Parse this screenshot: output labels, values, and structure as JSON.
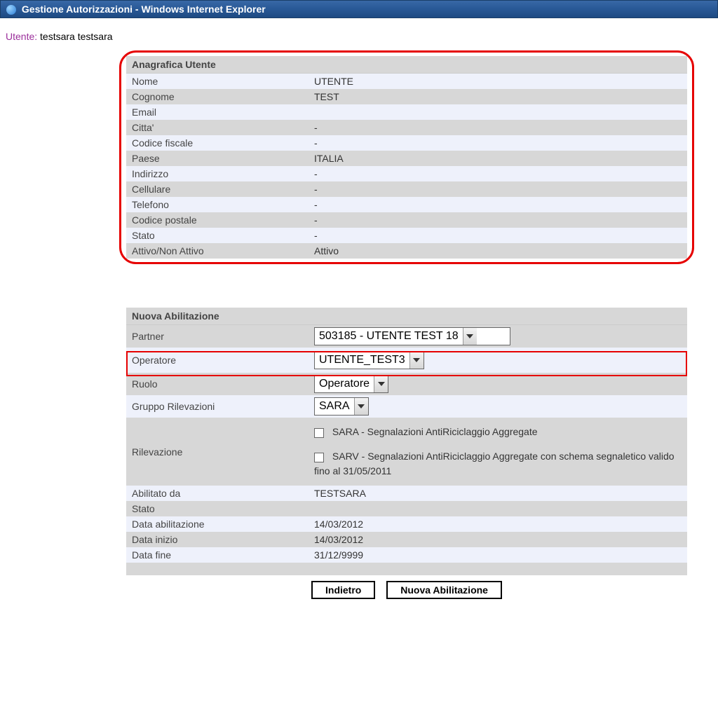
{
  "window": {
    "title": "Gestione Autorizzazioni - Windows Internet Explorer"
  },
  "user": {
    "label": "Utente:",
    "value": "testsara  testsara"
  },
  "anagrafica": {
    "header": "Anagrafica Utente",
    "rows": [
      {
        "label": "Nome",
        "value": "UTENTE"
      },
      {
        "label": "Cognome",
        "value": "TEST"
      },
      {
        "label": "Email",
        "value": ""
      },
      {
        "label": "Citta'",
        "value": "-"
      },
      {
        "label": "Codice fiscale",
        "value": "-"
      },
      {
        "label": "Paese",
        "value": "ITALIA"
      },
      {
        "label": "Indirizzo",
        "value": "-"
      },
      {
        "label": "Cellulare",
        "value": "-"
      },
      {
        "label": "Telefono",
        "value": "-"
      },
      {
        "label": "Codice postale",
        "value": "-"
      },
      {
        "label": "Stato",
        "value": "-"
      },
      {
        "label": "Attivo/Non Attivo",
        "value": "Attivo"
      }
    ]
  },
  "abilitazione": {
    "header": "Nuova Abilitazione",
    "partner_label": "Partner",
    "partner_value": "503185 - UTENTE TEST 18",
    "operatore_label": "Operatore",
    "operatore_value": "UTENTE_TEST3",
    "ruolo_label": "Ruolo",
    "ruolo_value": "Operatore",
    "gruppo_label": "Gruppo Rilevazioni",
    "gruppo_value": "SARA",
    "rilevazione_label": "Rilevazione",
    "rilevazione_opt1": "SARA  -  Segnalazioni AntiRiciclaggio Aggregate",
    "rilevazione_opt2": "SARV  -  Segnalazioni AntiRiciclaggio Aggregate con schema segnaletico valido fino al 31/05/2011",
    "abilitato_label": "Abilitato da",
    "abilitato_value": "TESTSARA",
    "stato_label": "Stato",
    "stato_value": "",
    "data_abil_label": "Data abilitazione",
    "data_abil_value": "14/03/2012",
    "data_inizio_label": "Data inizio",
    "data_inizio_value": "14/03/2012",
    "data_fine_label": "Data fine",
    "data_fine_value": "31/12/9999"
  },
  "buttons": {
    "back": "Indietro",
    "new": "Nuova Abilitazione"
  }
}
